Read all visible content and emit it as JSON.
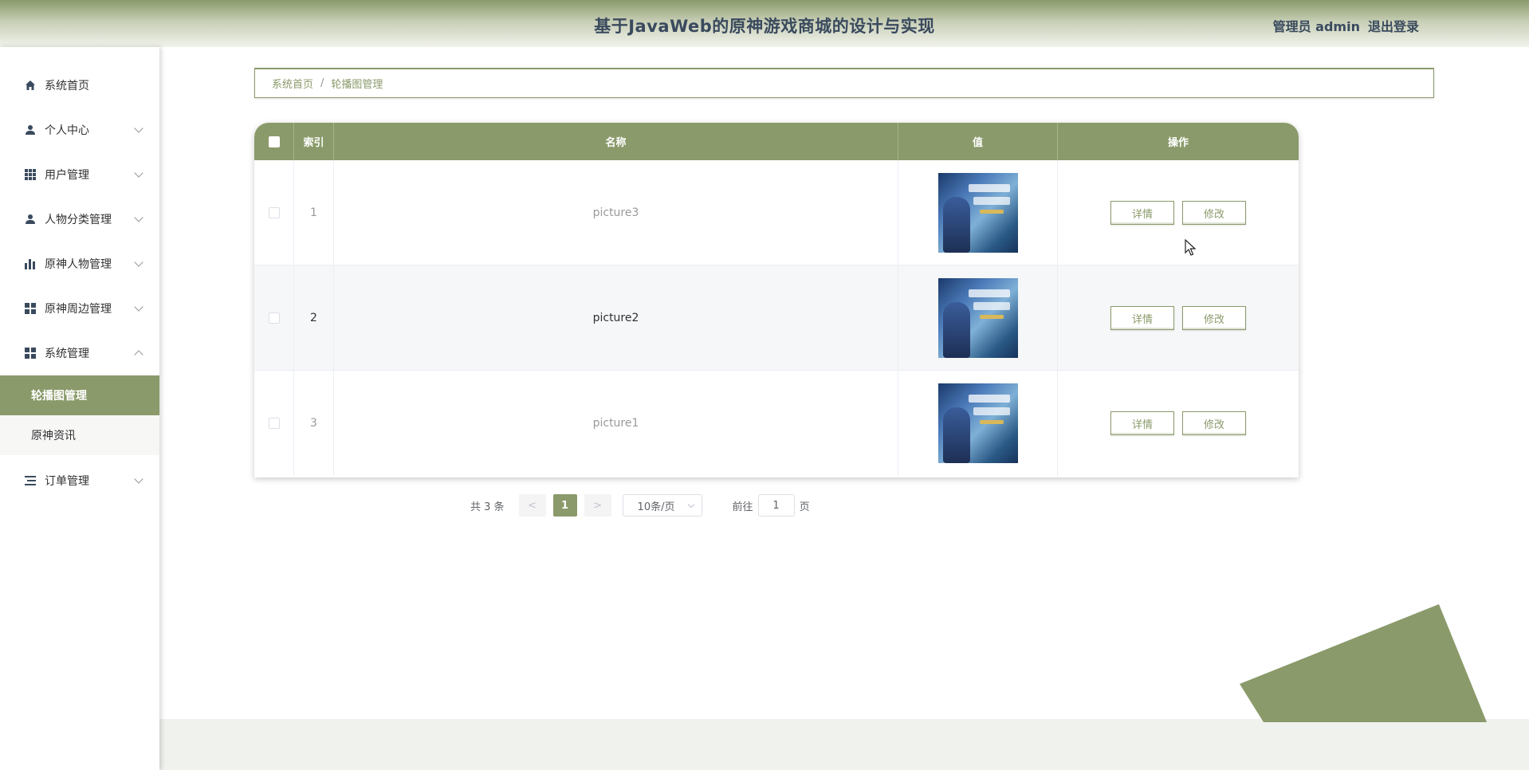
{
  "header": {
    "title": "基于JavaWeb的原神游戏商城的设计与实现",
    "user_label": "管理员 admin",
    "logout_label": "退出登录"
  },
  "sidebar": {
    "items": [
      {
        "label": "系统首页",
        "icon": "home-icon"
      },
      {
        "label": "个人中心",
        "icon": "user-icon"
      },
      {
        "label": "用户管理",
        "icon": "grid-icon"
      },
      {
        "label": "人物分类管理",
        "icon": "user-icon"
      },
      {
        "label": "原神人物管理",
        "icon": "bar-chart-icon"
      },
      {
        "label": "原神周边管理",
        "icon": "apps-icon"
      },
      {
        "label": "系统管理",
        "icon": "apps-icon"
      },
      {
        "label": "订单管理",
        "icon": "list-icon"
      }
    ],
    "subitems": [
      {
        "label": "轮播图管理",
        "active": true
      },
      {
        "label": "原神资讯",
        "active": false
      }
    ]
  },
  "breadcrumb": {
    "home": "系统首页",
    "separator": "/",
    "current": "轮播图管理"
  },
  "table": {
    "columns": [
      "索引",
      "名称",
      "值",
      "操作"
    ],
    "rows": [
      {
        "index": "1",
        "name": "picture3",
        "image": "banner-thumbnail"
      },
      {
        "index": "2",
        "name": "picture2",
        "image": "banner-thumbnail"
      },
      {
        "index": "3",
        "name": "picture1",
        "image": "banner-thumbnail"
      }
    ],
    "detail_label": "详情",
    "edit_label": "修改"
  },
  "pagination": {
    "total_text": "共 3 条",
    "prev": "<",
    "next": ">",
    "current_page": "1",
    "page_size": "10条/页",
    "goto_label": "前往",
    "goto_value": "1",
    "page_suffix": "页"
  },
  "colors": {
    "accent": "#8a9a6a",
    "header_text": "#3a4a5e"
  }
}
